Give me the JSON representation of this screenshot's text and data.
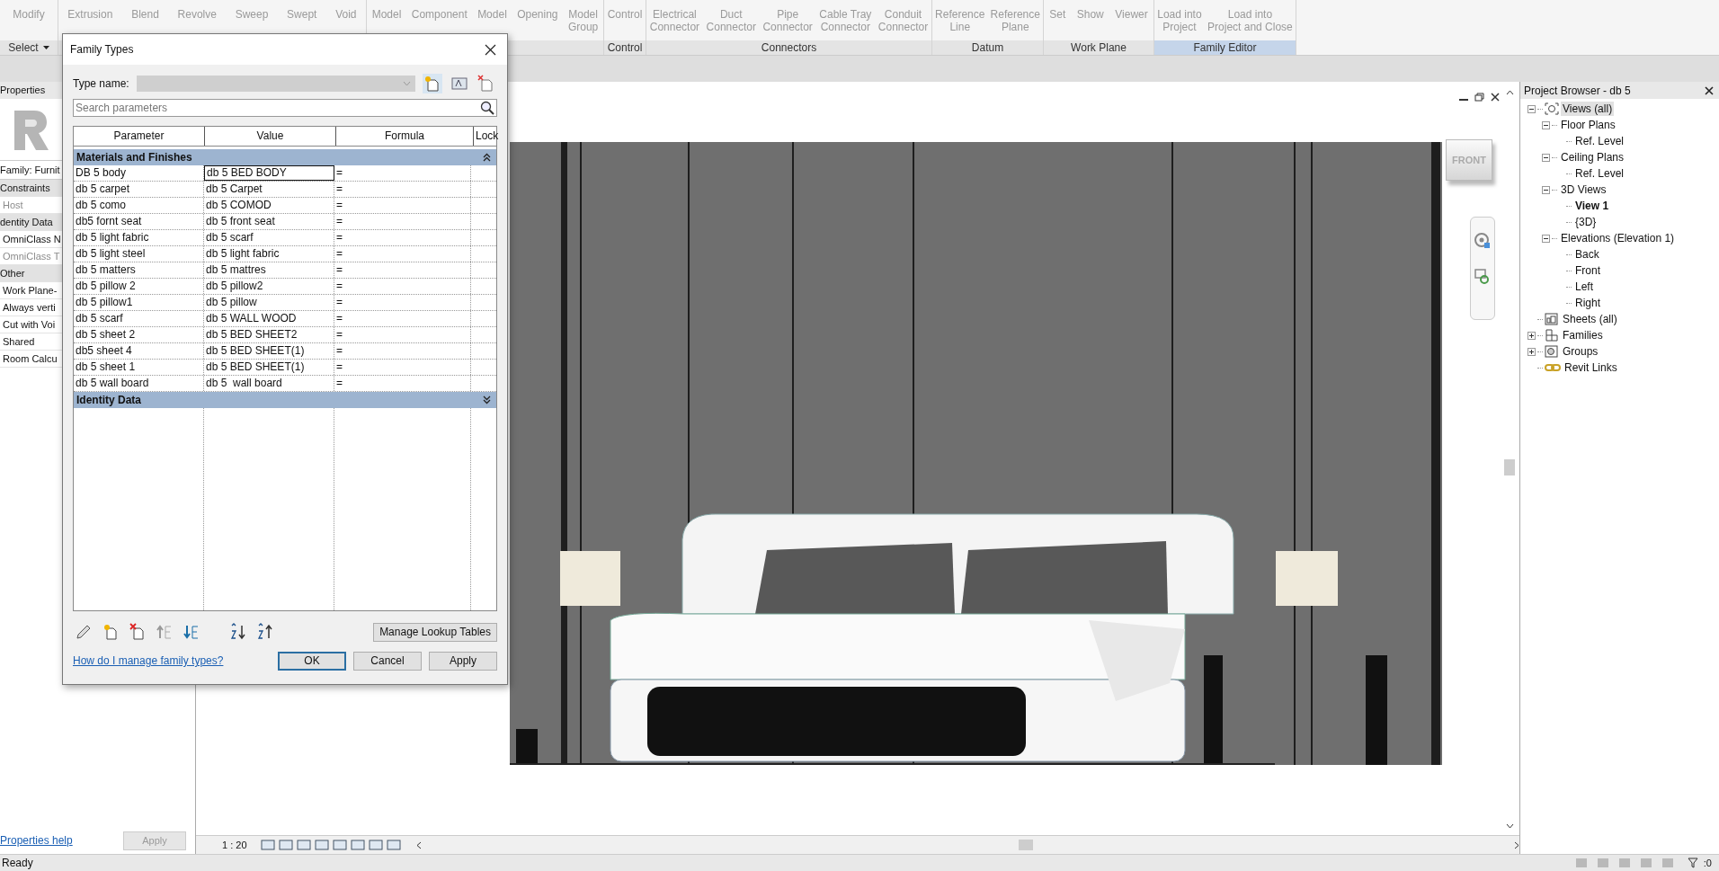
{
  "ribbon": {
    "panels": [
      {
        "label": "Select",
        "dropdown": true,
        "contextual": false,
        "items": [
          [
            "Modify"
          ]
        ]
      },
      {
        "items": [
          [
            "Extrusion"
          ],
          [
            "Blend"
          ],
          [
            "Revolve"
          ],
          [
            "Sweep"
          ],
          [
            "Swept"
          ],
          [
            "Void"
          ]
        ]
      },
      {
        "items": [
          [
            "Model"
          ],
          [
            "Component"
          ],
          [
            "Model"
          ],
          [
            "Opening"
          ],
          [
            "Model",
            "Group"
          ]
        ]
      },
      {
        "label": "Control",
        "contextual": false,
        "items": [
          [
            "Control"
          ]
        ]
      },
      {
        "label": "Connectors",
        "contextual": false,
        "items": [
          [
            "Electrical",
            "Connector"
          ],
          [
            "Duct",
            "Connector"
          ],
          [
            "Pipe",
            "Connector"
          ],
          [
            "Cable Tray",
            "Connector"
          ],
          [
            "Conduit",
            "Connector"
          ]
        ]
      },
      {
        "label": "Datum",
        "contextual": false,
        "items": [
          [
            "Reference",
            "Line"
          ],
          [
            "Reference",
            "Plane"
          ]
        ]
      },
      {
        "label": "Work Plane",
        "contextual": false,
        "items": [
          [
            "Set"
          ],
          [
            "Show"
          ],
          [
            "Viewer"
          ]
        ]
      },
      {
        "label": "Family Editor",
        "contextual": true,
        "items": [
          [
            "Load into",
            "Project"
          ],
          [
            "Load into",
            "Project and Close"
          ]
        ]
      }
    ]
  },
  "properties": {
    "title": "Properties",
    "family": "Family: Furnit",
    "rows": [
      {
        "kind": "group",
        "label": "Constraints",
        "disabled": false
      },
      {
        "kind": "param",
        "label": "Host",
        "disabled": true
      },
      {
        "kind": "group",
        "label": "dentity Data",
        "disabled": false
      },
      {
        "kind": "param",
        "label": "OmniClass N",
        "disabled": false
      },
      {
        "kind": "param",
        "label": "OmniClass T",
        "disabled": true
      },
      {
        "kind": "group",
        "label": "Other",
        "disabled": false
      },
      {
        "kind": "param",
        "label": "Work Plane-",
        "disabled": false
      },
      {
        "kind": "param",
        "label": "Always verti",
        "disabled": false
      },
      {
        "kind": "param",
        "label": "Cut with Voi",
        "disabled": false
      },
      {
        "kind": "param",
        "label": "Shared",
        "disabled": false
      },
      {
        "kind": "param",
        "label": "Room Calcu",
        "disabled": false
      }
    ],
    "help_link": "Properties help",
    "apply": {
      "label": "Apply",
      "disabled": true
    }
  },
  "dialog": {
    "title": "Family Types",
    "type_name": {
      "label": "Type name:",
      "disabled": true
    },
    "search": {
      "placeholder": "Search parameters"
    },
    "columns": [
      "Parameter",
      "Value",
      "Formula",
      "Lock"
    ],
    "groups": [
      {
        "name": "Materials and Finishes",
        "expanded": true,
        "rows": [
          {
            "parameter": "DB 5 body",
            "value": "db 5 BED BODY",
            "formula": "=",
            "selected": true
          },
          {
            "parameter": "db 5 carpet",
            "value": "db 5 Carpet",
            "formula": "=",
            "selected": false
          },
          {
            "parameter": "db 5 como",
            "value": "db 5 COMOD",
            "formula": "=",
            "selected": false
          },
          {
            "parameter": "db5 fornt seat",
            "value": "db 5 front seat",
            "formula": "=",
            "selected": false
          },
          {
            "parameter": "db 5 light fabric",
            "value": "db 5 scarf",
            "formula": "=",
            "selected": false
          },
          {
            "parameter": "db 5 light steel",
            "value": "db 5 light fabric",
            "formula": "=",
            "selected": false
          },
          {
            "parameter": "db 5 matters",
            "value": "db 5 mattres",
            "formula": "=",
            "selected": false
          },
          {
            "parameter": "db 5 pillow 2",
            "value": "db 5 pillow2",
            "formula": "=",
            "selected": false
          },
          {
            "parameter": "db 5 pillow1",
            "value": "db 5 pillow",
            "formula": "=",
            "selected": false
          },
          {
            "parameter": "db 5 scarf",
            "value": "db 5 WALL WOOD",
            "formula": "=",
            "selected": false
          },
          {
            "parameter": "db 5 sheet 2",
            "value": "db 5 BED SHEET2",
            "formula": "=",
            "selected": false
          },
          {
            "parameter": "db5 sheet 4",
            "value": "db 5 BED SHEET(1)",
            "formula": "=",
            "selected": false
          },
          {
            "parameter": "db 5 sheet 1",
            "value": "db 5 BED SHEET(1)",
            "formula": "=",
            "selected": false
          },
          {
            "parameter": "db 5 wall board",
            "value": "db 5  wall board",
            "formula": "=",
            "selected": false
          }
        ]
      },
      {
        "name": "Identity Data",
        "expanded": false
      }
    ],
    "lookup_button": "Manage Lookup Tables",
    "help_link": "How do I manage family types?",
    "buttons": [
      {
        "label": "OK",
        "default": true
      },
      {
        "label": "Cancel",
        "default": false
      },
      {
        "label": "Apply",
        "default": false
      }
    ]
  },
  "view": {
    "scale": "1 : 20",
    "view_cube": "FRONT"
  },
  "project_browser": {
    "title": "Project Browser - db 5",
    "items": [
      {
        "label": "Views (all)",
        "kind": "views",
        "selected": true,
        "current": false,
        "expanded": true,
        "children": [
          {
            "label": "Floor Plans",
            "selected": false,
            "current": false,
            "expanded": true,
            "children": [
              {
                "label": "Ref. Level",
                "selected": false,
                "current": false
              }
            ]
          },
          {
            "label": "Ceiling Plans",
            "selected": false,
            "current": false,
            "expanded": true,
            "children": [
              {
                "label": "Ref. Level",
                "selected": false,
                "current": false
              }
            ]
          },
          {
            "label": "3D Views",
            "selected": false,
            "current": false,
            "expanded": true,
            "children": [
              {
                "label": "View 1",
                "selected": false,
                "current": true
              },
              {
                "label": "{3D}",
                "selected": false,
                "current": false
              }
            ]
          },
          {
            "label": "Elevations (Elevation 1)",
            "selected": false,
            "current": false,
            "expanded": true,
            "children": [
              {
                "label": "Back",
                "selected": false,
                "current": false
              },
              {
                "label": "Front",
                "selected": false,
                "current": false
              },
              {
                "label": "Left",
                "selected": false,
                "current": false
              },
              {
                "label": "Right",
                "selected": false,
                "current": false
              }
            ]
          }
        ]
      },
      {
        "label": "Sheets (all)",
        "kind": "sheets",
        "selected": false,
        "current": false
      },
      {
        "label": "Families",
        "kind": "families",
        "selected": false,
        "current": false,
        "expanded": false
      },
      {
        "label": "Groups",
        "kind": "groups",
        "selected": false,
        "current": false,
        "expanded": false
      },
      {
        "label": "Revit Links",
        "kind": "links",
        "selected": false,
        "current": false
      }
    ]
  },
  "status_bar": {
    "text": "Ready",
    "filter_count": ":0"
  }
}
